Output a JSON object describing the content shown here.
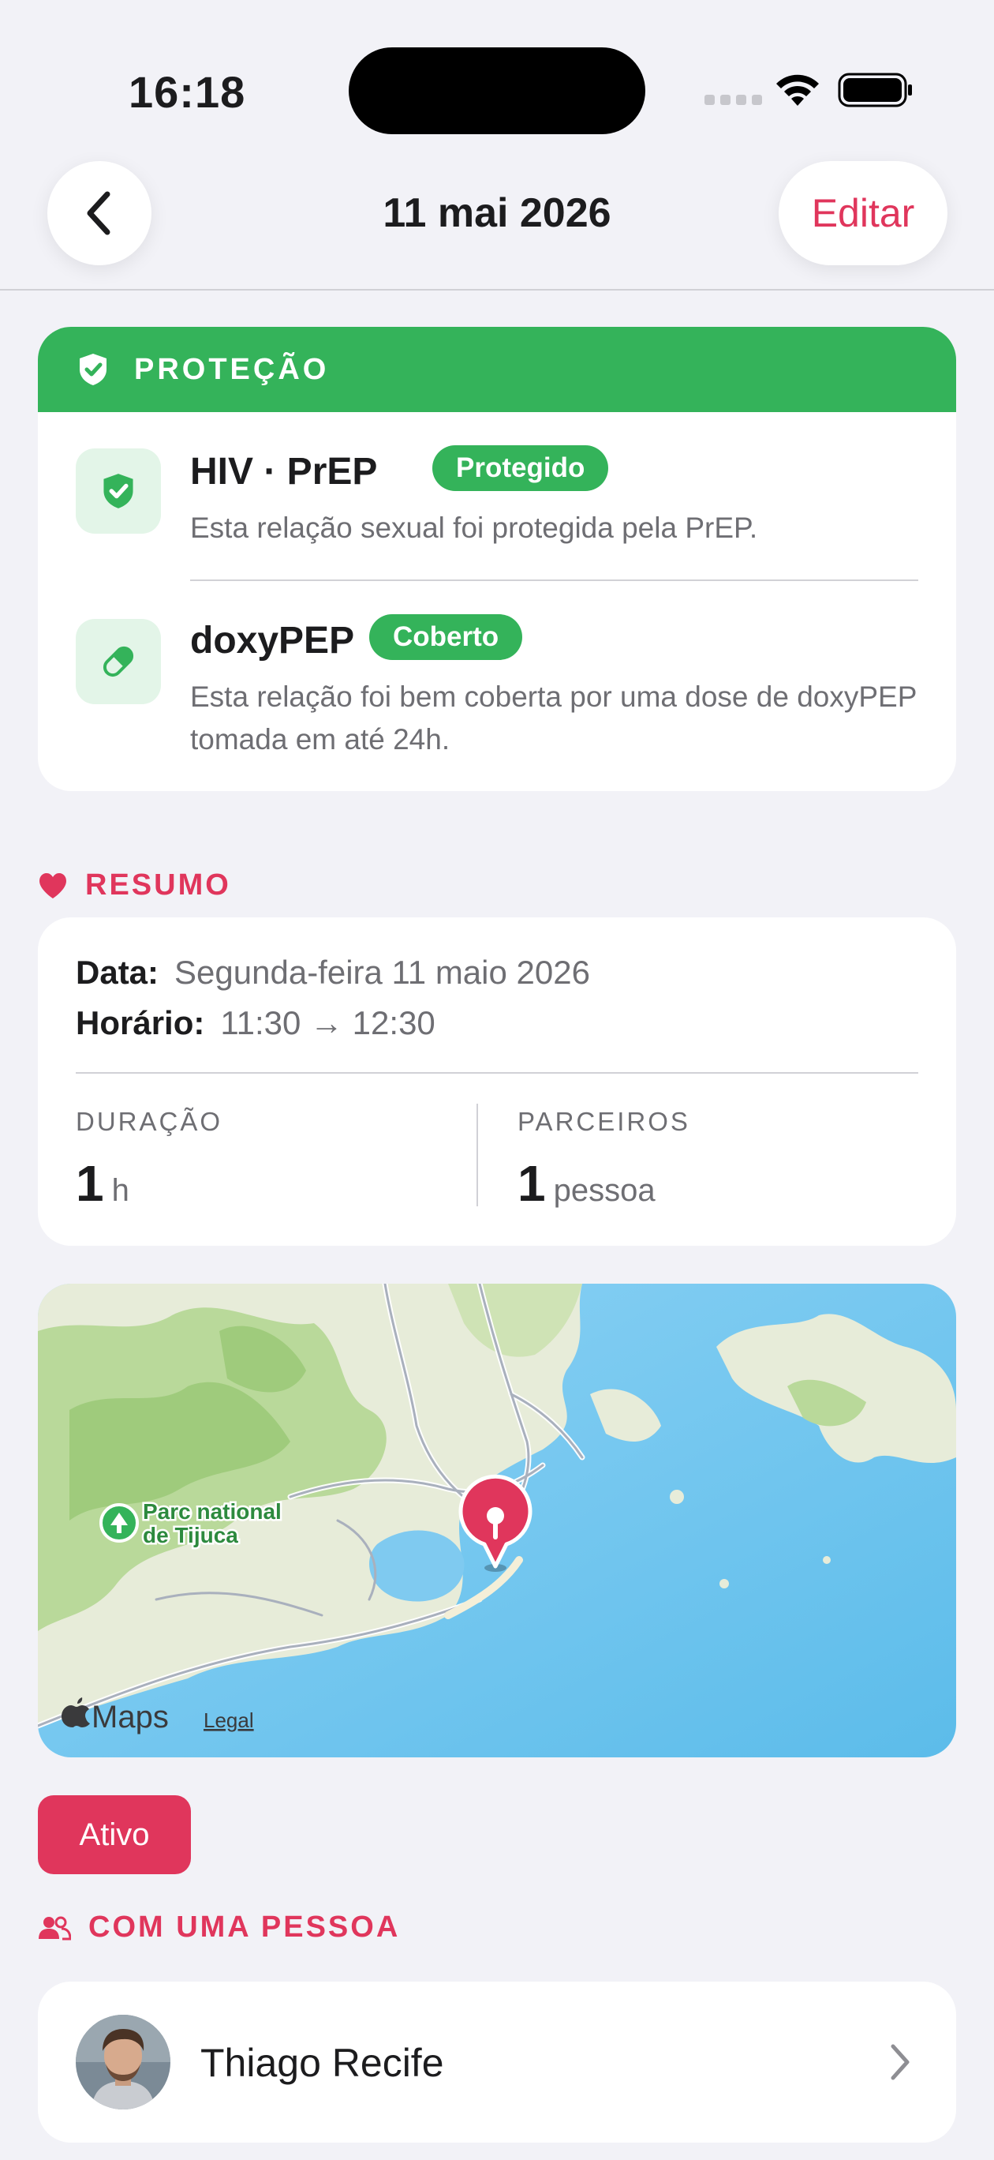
{
  "status_bar": {
    "time": "16:18"
  },
  "nav": {
    "title": "11 mai 2026",
    "edit_label": "Editar"
  },
  "protection": {
    "header": "PROTEÇÃO",
    "items": [
      {
        "title": "HIV · PrEP",
        "badge": "Protegido",
        "description": "Esta relação sexual foi protegida pela PrEP.",
        "icon": "shield-check-icon"
      },
      {
        "title": "doxyPEP",
        "badge": "Coberto",
        "description": "Esta relação foi bem coberta por uma dose de doxyPEP tomada em até 24h.",
        "icon": "pill-icon"
      }
    ]
  },
  "summary": {
    "header": "RESUMO",
    "date_label": "Data:",
    "date_value": "Segunda-feira 11 maio 2026",
    "time_label": "Horário:",
    "time_value": "11:30 → 12:30",
    "duration_label": "DURAÇÃO",
    "duration_value": "1",
    "duration_unit": "h",
    "partners_label": "PARCEIROS",
    "partners_value": "1",
    "partners_unit": "pessoa"
  },
  "map": {
    "park_label_line1": "Parc national",
    "park_label_line2": "de Tijuca",
    "maps_brand": "Maps",
    "legal_link": "Legal"
  },
  "status_pill": "Ativo",
  "partners_section": {
    "header": "COM UMA PESSOA",
    "person_name": "Thiago Recife"
  },
  "colors": {
    "accent": "#e0365c",
    "protection_green": "#34b35a",
    "background": "#f2f2f7"
  }
}
